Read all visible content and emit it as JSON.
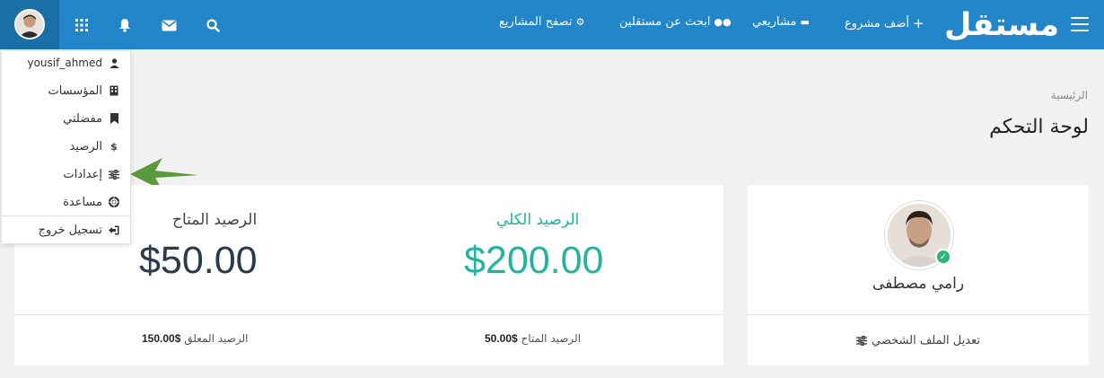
{
  "nav": {
    "logo": "مستقل",
    "add_project": "أضف مشروع",
    "add_project_icon": "+",
    "my_projects": "مشاريعي",
    "find_freelancers": "ابحث عن مستقلين",
    "browse_projects": "تصفح المشاريع",
    "icons": [
      "search-icon",
      "envelope-icon",
      "bell-icon",
      "grid-icon",
      "user-avatar",
      "hamburger-icon"
    ]
  },
  "dropdown": {
    "items": [
      {
        "label": "yousif_ahmed",
        "icon": "user-icon"
      },
      {
        "label": "المؤسسات",
        "icon": "building-icon"
      },
      {
        "label": "مفضلتي",
        "icon": "bookmark-icon"
      },
      {
        "label": "الرصيد",
        "icon": "dollar-icon",
        "glyph": "$"
      },
      {
        "label": "إعدادات",
        "icon": "sliders-icon"
      },
      {
        "label": "مساعدة",
        "icon": "lifebuoy-icon"
      },
      {
        "label": "تسجيل خروج",
        "icon": "signout-icon"
      }
    ]
  },
  "breadcrumb": "الرئيسية",
  "page_title": "لوحة التحكم",
  "profile": {
    "name": "رامي مصطفى",
    "edit_label": "تعديل الملف الشخصي",
    "verified_glyph": "✓"
  },
  "balance": {
    "total_label": "الرصيد الكلي",
    "total_value": "$200.00",
    "available_label": "الرصيد المتاح",
    "available_value": "$50.00",
    "footer_available_label": "الرصيد المتاح",
    "footer_available_value": "$50.00",
    "footer_pending_label": "الرصيد المعلق",
    "footer_pending_value": "$150.00"
  },
  "colors": {
    "navbar": "#2386c8",
    "accent_green": "#21b59b",
    "arrow": "#5b9a3c"
  }
}
